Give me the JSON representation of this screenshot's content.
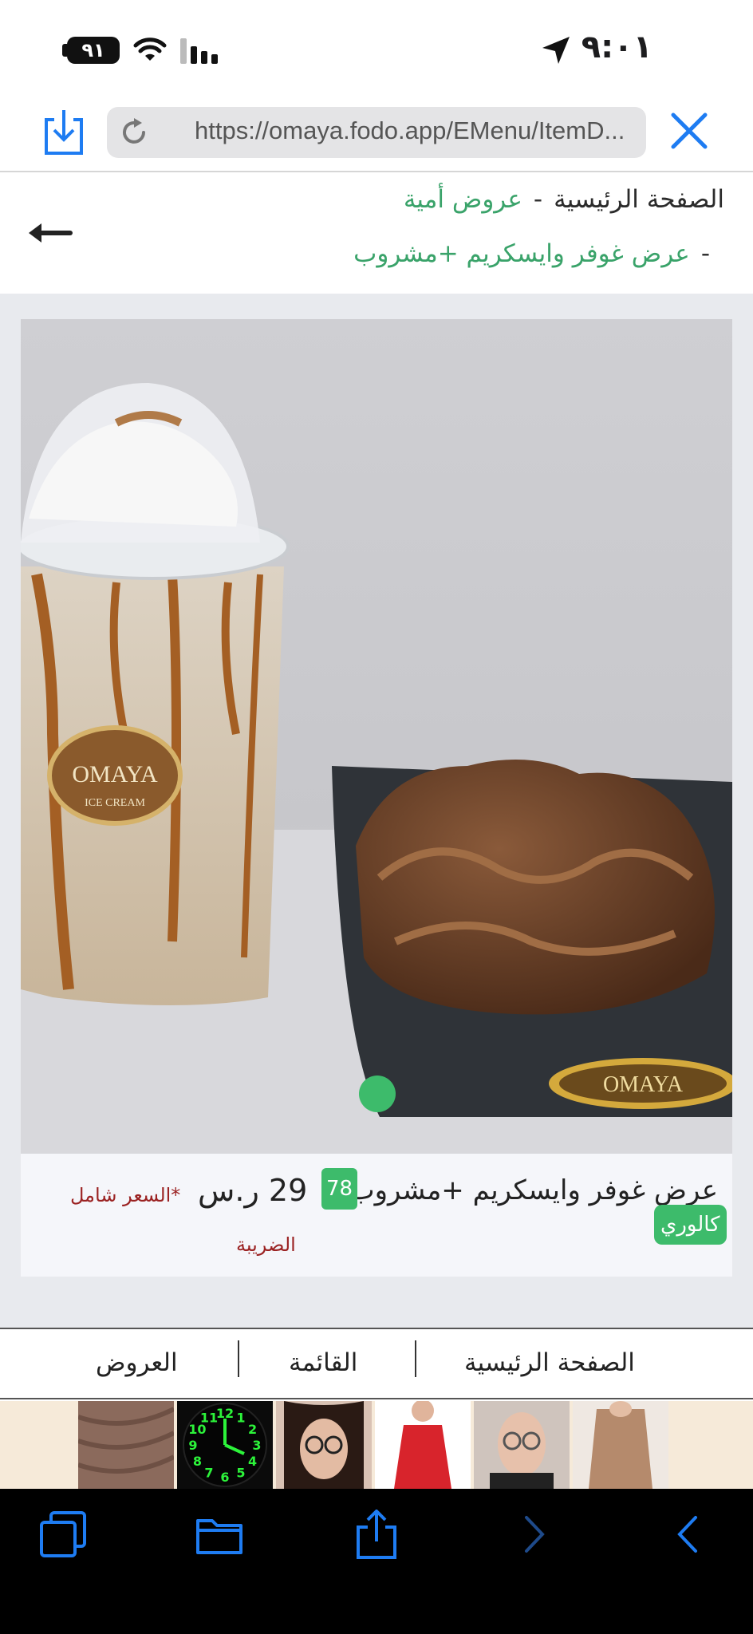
{
  "status_bar": {
    "time": "٩:٠١",
    "battery": "٩١"
  },
  "browser": {
    "url": "https://omaya.fodo.app/EMenu/ItemD..."
  },
  "breadcrumb": {
    "home": "الصفحة الرئيسية",
    "separator": "-",
    "category": "عروض أمية",
    "item": "عرض غوفر وايسكريم +مشروب"
  },
  "product": {
    "name": "عرض غوفر وايسكريم +مشروب",
    "calories_value": "78",
    "calories_label": "كالوري",
    "price": "29 ر.س",
    "tax_note_line1": "*السعر شامل",
    "tax_note_line2": "الضريبة",
    "image_text": {
      "cup_brand": "OMAYA",
      "cup_sub": "ICE CREAM",
      "box_brand": "OMAYA"
    }
  },
  "site_nav": {
    "home": "الصفحة الرئيسية",
    "menu": "القائمة",
    "offers": "العروض"
  },
  "ad_strip": {
    "tiles": [
      "fabric-swatch",
      "digital-wall-clock",
      "woman-glasses",
      "red-dress",
      "woman-glasses-2",
      "loungewear-set"
    ],
    "clock_numbers": [
      "12",
      "1",
      "2",
      "3",
      "4",
      "5",
      "6",
      "7",
      "8",
      "9",
      "10",
      "11"
    ]
  },
  "toolbar": {
    "icons": [
      "tabs-icon",
      "bookmarks-icon",
      "share-icon",
      "forward-icon",
      "back-icon"
    ]
  },
  "colors": {
    "accent_green": "#3dbb6b",
    "link_green": "#3aa36a",
    "ios_blue": "#1e7cf2",
    "tax_red": "#9b2222"
  }
}
